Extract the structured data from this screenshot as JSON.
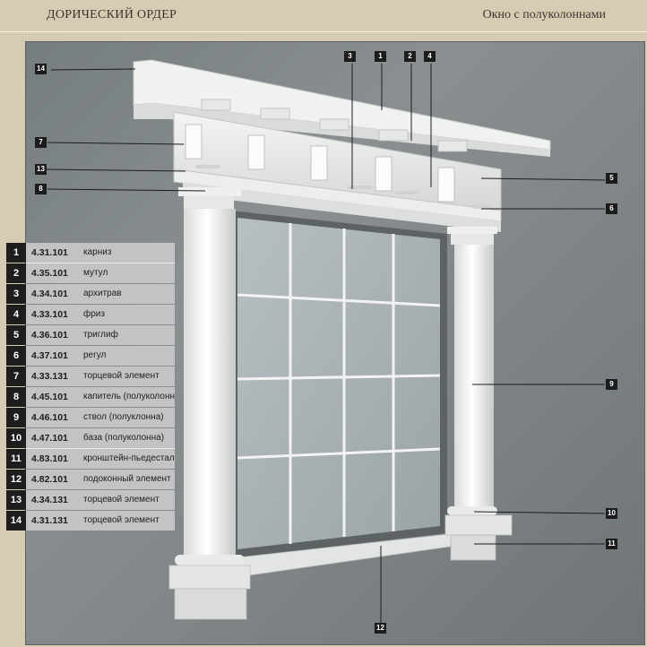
{
  "header": {
    "title": "ДОРИЧЕСКИЙ ОРДЕР",
    "subtitle": "Окно с полуколоннами"
  },
  "legend": [
    {
      "num": "1",
      "code": "4.31.101",
      "name": "карниз"
    },
    {
      "num": "2",
      "code": "4.35.101",
      "name": "мутул"
    },
    {
      "num": "3",
      "code": "4.34.101",
      "name": "архитрав"
    },
    {
      "num": "4",
      "code": "4.33.101",
      "name": "фриз"
    },
    {
      "num": "5",
      "code": "4.36.101",
      "name": "триглиф"
    },
    {
      "num": "6",
      "code": "4.37.101",
      "name": "регул"
    },
    {
      "num": "7",
      "code": "4.33.131",
      "name": "торцевой элемент"
    },
    {
      "num": "8",
      "code": "4.45.101",
      "name": "капитель (полуколонна)"
    },
    {
      "num": "9",
      "code": "4.46.101",
      "name": "ствол (полуклонна)"
    },
    {
      "num": "10",
      "code": "4.47.101",
      "name": "база (полуколонна)"
    },
    {
      "num": "11",
      "code": "4.83.101",
      "name": "кронштейн-пьедестал"
    },
    {
      "num": "12",
      "code": "4.82.101",
      "name": "подоконный элемент"
    },
    {
      "num": "13",
      "code": "4.34.131",
      "name": "торцевой элемент"
    },
    {
      "num": "14",
      "code": "4.31.131",
      "name": "торцевой элемент"
    }
  ],
  "callouts": [
    "1",
    "2",
    "3",
    "4",
    "5",
    "6",
    "7",
    "8",
    "9",
    "10",
    "11",
    "12",
    "13",
    "14"
  ],
  "colors": {
    "background": "#d6ccb4",
    "wall": "#7b8182",
    "molding": "#eef0ee",
    "glass": "#a8b1b4",
    "badge": "#1c1c1c",
    "legend_row": "#c3c3c6"
  }
}
